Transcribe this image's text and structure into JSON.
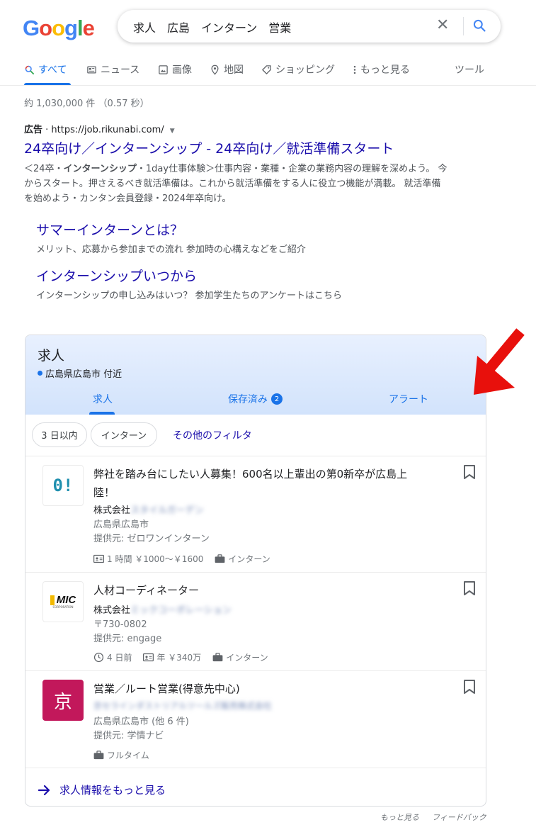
{
  "logo": {
    "letters": [
      "G",
      "o",
      "o",
      "g",
      "l",
      "e"
    ]
  },
  "search": {
    "query": "求人　広島　インターン　営業"
  },
  "nav": {
    "tabs": [
      {
        "label": "すべて",
        "icon": "search-icon"
      },
      {
        "label": "ニュース",
        "icon": "news-icon"
      },
      {
        "label": "画像",
        "icon": "image-icon"
      },
      {
        "label": "地図",
        "icon": "map-pin-icon"
      },
      {
        "label": "ショッピング",
        "icon": "tag-icon"
      },
      {
        "label": "もっと見る",
        "icon": "more-vert-icon"
      }
    ],
    "tools": "ツール"
  },
  "stats": "約 1,030,000 件 （0.57 秒）",
  "ad": {
    "label": "広告",
    "url": "https://job.rikunabi.com/",
    "title": "24卒向け／インターンシップ - 24卒向け／就活準備スタート",
    "desc_pre": "＜24卒・",
    "desc_bold": "インターンシップ",
    "desc_post": "・1day仕事体験＞仕事内容・業種・企業の業務内容の理解を深めよう。 今からスタート。押さえるべき就活準備は。これから就活準備をする人に役立つ機能が満載。 就活準備を始めよう・カンタン会員登録・2024年卒向け。",
    "sitelinks": [
      {
        "title": "サマーインターンとは？",
        "desc": "メリット、応募から参加までの流れ 参加時の心構えなどをご紹介"
      },
      {
        "title": "インターンシップいつから",
        "desc": "インターンシップの申し込みはいつ？ 参加学生たちのアンケートはこちら"
      }
    ]
  },
  "jobs": {
    "title": "求人",
    "location": "広島県広島市 付近",
    "tabs": [
      {
        "label": "求人"
      },
      {
        "label": "保存済み",
        "badge": "2"
      },
      {
        "label": "アラート"
      }
    ],
    "chips": [
      "3 日以内",
      "インターン"
    ],
    "more_filters": "その他のフィルタ",
    "items": [
      {
        "logo_text": "0!",
        "title": "弊社を踏み台にしたい人募集！600名以上輩出の第0新卒が広島上陸！",
        "company_prefix": "株式会社",
        "company_blur": "スタイルガーデン",
        "location": "広島県広島市",
        "source": "提供元: ゼロワンインターン",
        "salary": "1 時間 ￥1000～￥1600",
        "type": "インターン"
      },
      {
        "logo_text": "MIC",
        "logo_sub": "CORPORATION",
        "title": "人材コーディネーター",
        "company_prefix": "株式会社",
        "company_blur": "ミックコーポレーション",
        "location": "〒730-0802",
        "source": "提供元: engage",
        "posted": "4 日前",
        "salary": "年 ￥340万",
        "type": "インターン"
      },
      {
        "logo_text": "京",
        "logo_color": "#c2185b",
        "title": "営業／ルート営業(得意先中心)",
        "company_blur": "京セラインダストリアルツールズ販売株式会社",
        "location": "広島県広島市 (他 6 件)",
        "source": "提供元: 学情ナビ",
        "type": "フルタイム"
      }
    ],
    "more_jobs": "求人情報をもっと見る"
  },
  "footer": {
    "more": "もっと見る",
    "feedback": "フィードバック"
  },
  "colors": {
    "link": "#1a0dab",
    "accent": "#1a73e8",
    "arrow": "#e8100c"
  }
}
